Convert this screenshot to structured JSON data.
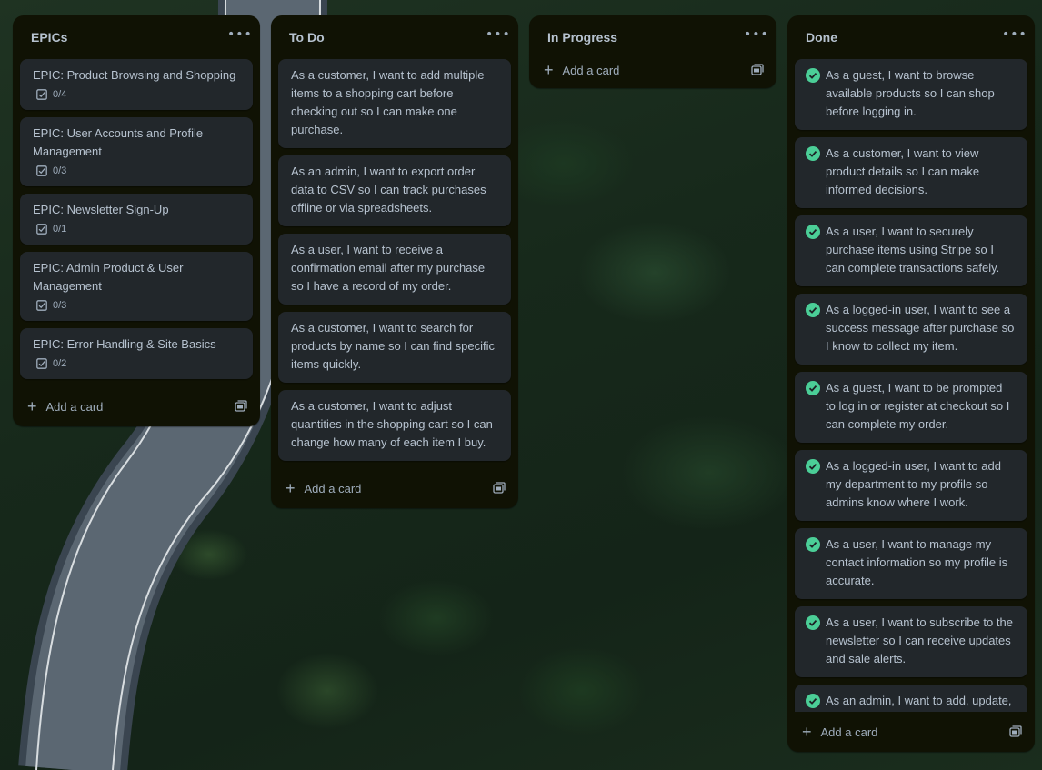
{
  "lists": [
    {
      "title": "EPICs",
      "menu": "•••",
      "add_label": "Add a card",
      "cards": [
        {
          "text": "EPIC: Product Browsing and Shopping",
          "badge": "0/4"
        },
        {
          "text": "EPIC: User Accounts and Profile Management",
          "badge": "0/3"
        },
        {
          "text": "EPIC: Newsletter Sign-Up",
          "badge": "0/1"
        },
        {
          "text": "EPIC: Admin Product & User Management",
          "badge": "0/3"
        },
        {
          "text": "EPIC: Error Handling & Site Basics",
          "badge": "0/2"
        }
      ]
    },
    {
      "title": "To Do",
      "menu": "•••",
      "add_label": "Add a card",
      "cards": [
        {
          "text": "As a customer, I want to add multiple items to a shopping cart before checking out so I can make one purchase."
        },
        {
          "text": "As an admin, I want to export order data to CSV so I can track purchases offline or via spreadsheets."
        },
        {
          "text": "As a user, I want to receive a confirmation email after my purchase so I have a record of my order."
        },
        {
          "text": "As a customer, I want to search for products by name so I can find specific items quickly."
        },
        {
          "text": "As a customer, I want to adjust quantities in the shopping cart so I can change how many of each item I buy."
        }
      ]
    },
    {
      "title": "In Progress",
      "menu": "•••",
      "add_label": "Add a card",
      "cards": []
    },
    {
      "title": "Done",
      "menu": "•••",
      "add_label": "Add a card",
      "cards": [
        {
          "text": "As a guest, I want to browse available products so I can shop before logging in."
        },
        {
          "text": "As a customer, I want to view product details so I can make informed decisions."
        },
        {
          "text": "As a user, I want to securely purchase items using Stripe so I can complete transactions safely."
        },
        {
          "text": "As a logged-in user, I want to see a success message after purchase so I know to collect my item."
        },
        {
          "text": "As a guest, I want to be prompted to log in or register at checkout so I can complete my order."
        },
        {
          "text": "As a logged-in user, I want to add my department to my profile so admins know where I work."
        },
        {
          "text": "As a user, I want to manage my contact information so my profile is accurate."
        },
        {
          "text": "As a user, I want to subscribe to the newsletter so I can receive updates and sale alerts."
        },
        {
          "text": "As an admin, I want to add, update, and delete products via"
        }
      ]
    }
  ],
  "colors": {
    "list_bg": "#101204",
    "card_bg": "#22272b",
    "text": "#b6c2cf",
    "done_check": "#1f845a"
  }
}
